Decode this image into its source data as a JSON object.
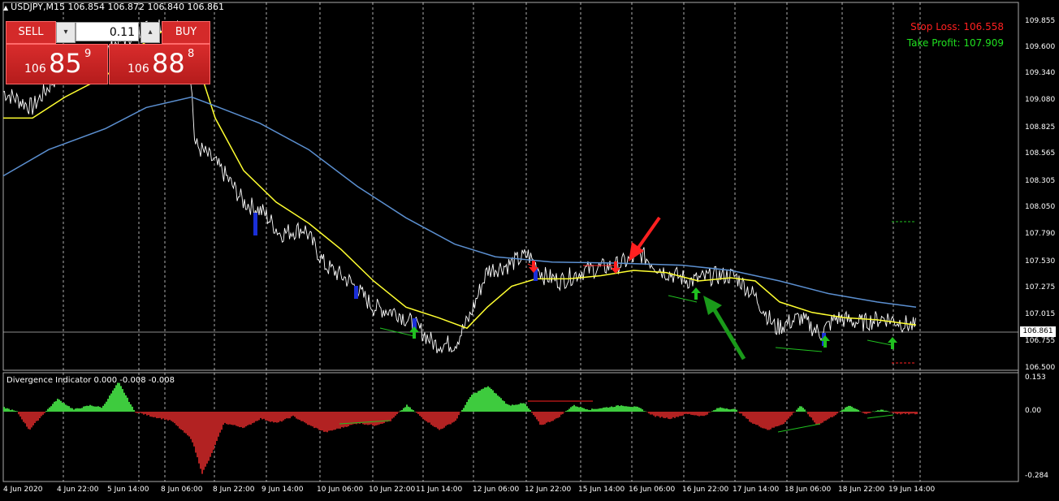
{
  "window": {
    "title": "USDJPY,M15  106.854 106.872 106.840 106.861",
    "indicator_title": "Divergence Indicator 0.000 -0.008 -0.008"
  },
  "trade_panel": {
    "sell_label": "SELL",
    "buy_label": "BUY",
    "lot_value": "0.11",
    "spin_down": "▾",
    "spin_up": "▴",
    "bid": {
      "prefix": "106",
      "big": "85",
      "sup": "9"
    },
    "ask": {
      "prefix": "106",
      "big": "88",
      "sup": "8"
    }
  },
  "stop_loss": "Stop Loss: 106.558",
  "take_profit": "Take Profit: 107.909",
  "current_price": "106.861",
  "price_axis": [
    "109.855",
    "109.600",
    "109.340",
    "109.080",
    "108.825",
    "108.565",
    "108.305",
    "108.050",
    "107.790",
    "107.530",
    "107.275",
    "107.015",
    "106.755",
    "106.500"
  ],
  "indicator_axis": [
    "0.153",
    "0.00",
    "-0.284"
  ],
  "time_axis": [
    "4 Jun 2020",
    "4 Jun 22:00",
    "5 Jun 14:00",
    "8 Jun 06:00",
    "8 Jun 22:00",
    "9 Jun 14:00",
    "10 Jun 06:00",
    "10 Jun 22:00",
    "11 Jun 14:00",
    "12 Jun 06:00",
    "12 Jun 22:00",
    "15 Jun 14:00",
    "16 Jun 06:00",
    "16 Jun 22:00",
    "17 Jun 14:00",
    "18 Jun 06:00",
    "18 Jun 22:00",
    "19 Jun 14:00"
  ],
  "colors": {
    "price": "#ffffff",
    "ma_fast": "#ffff30",
    "ma_slow": "#5b8fd0",
    "hist_pos": "#3ecb3e",
    "hist_neg": "#b22222",
    "grid": "#ffffff",
    "sell_arrow": "#ff2020",
    "buy_arrow": "#20c020"
  },
  "chart_data": {
    "type": "line",
    "title": "USDJPY,M15",
    "x": [
      "4 Jun 2020",
      "4 Jun 22:00",
      "5 Jun 14:00",
      "8 Jun 06:00",
      "8 Jun 22:00",
      "9 Jun 14:00",
      "10 Jun 06:00",
      "10 Jun 22:00",
      "11 Jun 14:00",
      "12 Jun 06:00",
      "12 Jun 22:00",
      "15 Jun 14:00",
      "16 Jun 06:00",
      "16 Jun 22:00",
      "17 Jun 14:00",
      "18 Jun 06:00",
      "18 Jun 22:00",
      "19 Jun 14:00"
    ],
    "ylim": [
      106.45,
      109.95
    ],
    "series": [
      {
        "name": "",
        "values": [
          109.2,
          109.35,
          109.55,
          109.3,
          108.6,
          108.2,
          107.4,
          107.0,
          106.9,
          107.45,
          107.3,
          107.35,
          107.5,
          107.3,
          107.2,
          106.85,
          106.95,
          106.86
        ]
      }
    ],
    "grid": true
  }
}
